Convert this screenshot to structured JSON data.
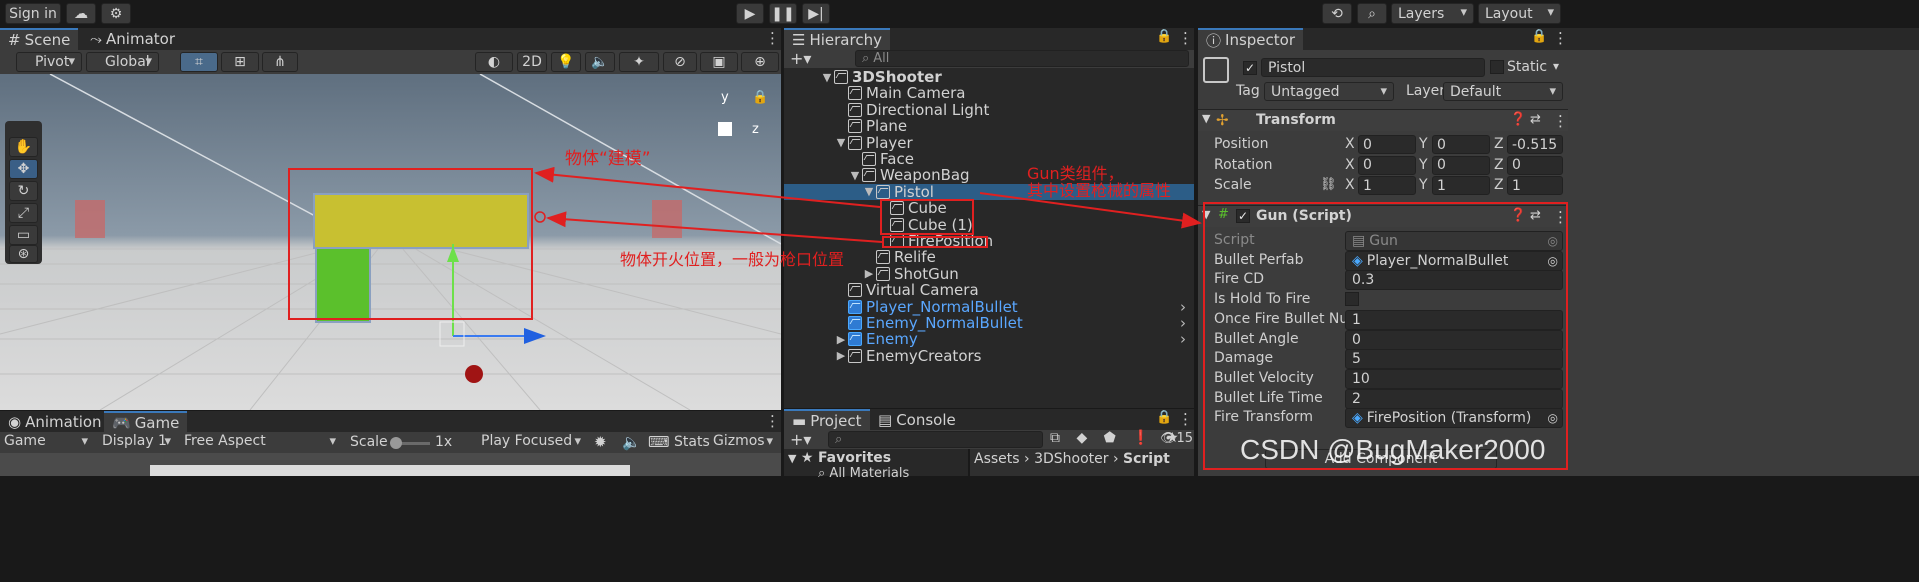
{
  "toolbar": {
    "sign_in": "Sign in",
    "layers": "Layers",
    "layout": "Layout"
  },
  "scene": {
    "tabs": [
      "Scene",
      "Animator"
    ],
    "pivot": "Pivot",
    "global": "Global",
    "mode_2d": "2D",
    "gizmo_y": "y",
    "gizmo_z": "z"
  },
  "game": {
    "tabs": [
      "Animation",
      "Game"
    ],
    "display_mode": "Game",
    "display": "Display 1",
    "aspect": "Free Aspect",
    "scale_label": "Scale",
    "scale_value": "1x",
    "play_focused": "Play Focused",
    "stats": "Stats",
    "gizmos": "Gizmos"
  },
  "hierarchy": {
    "tab": "Hierarchy",
    "search_placeholder": "All",
    "items": [
      {
        "label": "3DShooter",
        "depth": 0,
        "expanded": true,
        "scene": true
      },
      {
        "label": "Main Camera",
        "depth": 1
      },
      {
        "label": "Directional Light",
        "depth": 1
      },
      {
        "label": "Plane",
        "depth": 1
      },
      {
        "label": "Player",
        "depth": 1,
        "expanded": true
      },
      {
        "label": "Face",
        "depth": 2
      },
      {
        "label": "WeaponBag",
        "depth": 2,
        "expanded": true
      },
      {
        "label": "Pistol",
        "depth": 3,
        "expanded": true,
        "selected": true
      },
      {
        "label": "Cube",
        "depth": 4
      },
      {
        "label": "Cube (1)",
        "depth": 4
      },
      {
        "label": "FirePosition",
        "depth": 4
      },
      {
        "label": "Relife",
        "depth": 3
      },
      {
        "label": "ShotGun",
        "depth": 3,
        "collapsed": true
      },
      {
        "label": "Virtual Camera",
        "depth": 1
      },
      {
        "label": "Player_NormalBullet",
        "depth": 1,
        "prefab": true
      },
      {
        "label": "Enemy_NormalBullet",
        "depth": 1,
        "prefab": true
      },
      {
        "label": "Enemy",
        "depth": 1,
        "prefab": true,
        "collapsed": true
      },
      {
        "label": "EnemyCreators",
        "depth": 1,
        "collapsed": true
      }
    ]
  },
  "project": {
    "tabs": [
      "Project",
      "Console"
    ],
    "count": "15",
    "favorites": "Favorites",
    "all_materials": "All Materials",
    "breadcrumb": [
      "Assets",
      "3DShooter",
      "Script"
    ]
  },
  "inspector": {
    "tab": "Inspector",
    "object_name": "Pistol",
    "static_label": "Static",
    "tag_label": "Tag",
    "tag_value": "Untagged",
    "layer_label": "Layer",
    "layer_value": "Default",
    "transform": {
      "title": "Transform",
      "rows": [
        {
          "label": "Position",
          "x": "0",
          "y": "0",
          "z": "-0.515"
        },
        {
          "label": "Rotation",
          "x": "0",
          "y": "0",
          "z": "0"
        },
        {
          "label": "Scale",
          "x": "1",
          "y": "1",
          "z": "1"
        }
      ],
      "axis": [
        "X",
        "Y",
        "Z"
      ]
    },
    "script": {
      "title": "Gun (Script)",
      "props": [
        {
          "label": "Script",
          "value": "Gun",
          "dim": true
        },
        {
          "label": "Bullet Perfab",
          "value": "Player_NormalBullet",
          "ref": true
        },
        {
          "label": "Fire CD",
          "value": "0.3"
        },
        {
          "label": "Is Hold To Fire",
          "value": "",
          "checkbox": true
        },
        {
          "label": "Once Fire Bullet Numb",
          "value": "1"
        },
        {
          "label": "Bullet Angle",
          "value": "0"
        },
        {
          "label": "Damage",
          "value": "5"
        },
        {
          "label": "Bullet Velocity",
          "value": "10"
        },
        {
          "label": "Bullet Life Time",
          "value": "2"
        },
        {
          "label": "Fire Transform",
          "value": "FirePosition (Transform)",
          "ref": true
        }
      ],
      "add_component": "Add Component"
    }
  },
  "annotations": {
    "model": "物体“建模”",
    "gun_line1": "Gun类组件，",
    "gun_line2": "其中设置枪械的属性",
    "fire_pos": "物体开火位置，一般为枪口位置"
  },
  "watermark": "CSDN @BugMaker2000",
  "colors": {
    "accent": "#3a79bb",
    "selected_row": "#2c5d87",
    "prefab_text": "#5aa7ff",
    "annotation": "#e02020",
    "gun_yellow": "#c8c031",
    "gun_green": "#5bc02c"
  }
}
